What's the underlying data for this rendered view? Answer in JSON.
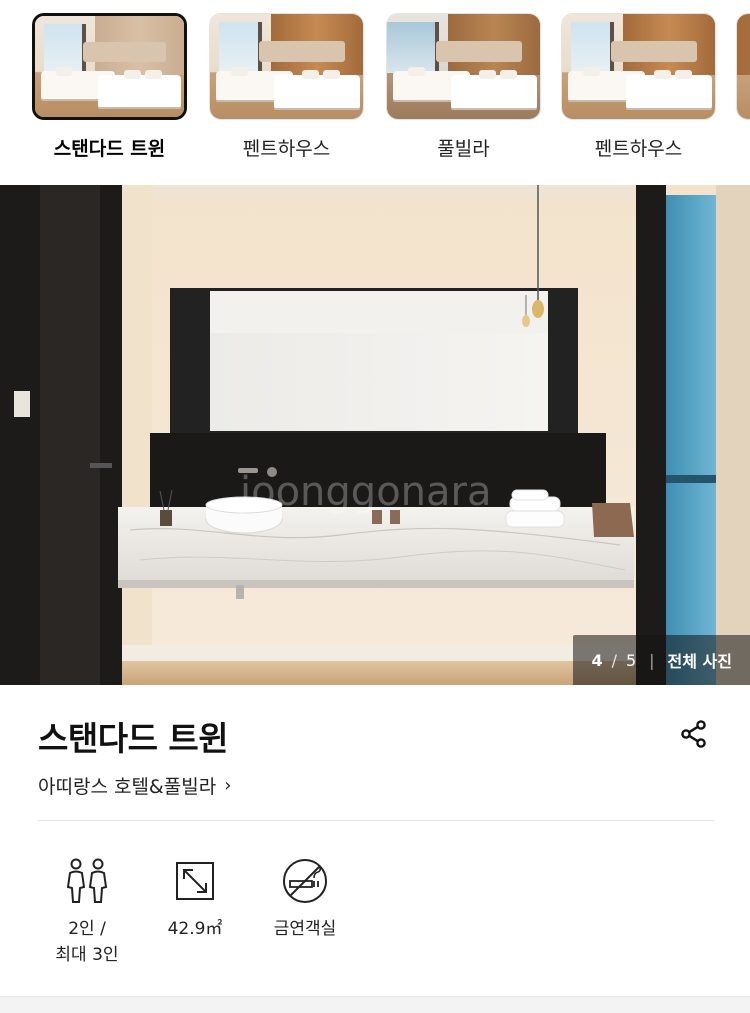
{
  "room_types": [
    {
      "label": "스탠다드 트윈",
      "selected": true
    },
    {
      "label": "펜트하우스",
      "selected": false
    },
    {
      "label": "풀빌라",
      "selected": false
    },
    {
      "label": "펜트하우스",
      "selected": false
    }
  ],
  "gallery": {
    "current": "4",
    "separator": "/",
    "total": "5",
    "view_all": "전체 사진"
  },
  "room": {
    "title": "스탠다드 트윈",
    "hotel_link": "아띠랑스 호텔&풀빌라",
    "hotel_chevron": "›"
  },
  "amenities": {
    "guests_line1": "2인 /",
    "guests_line2": "최대 3인",
    "size": "42.9㎡",
    "smoking": "금연객실"
  },
  "icons": {
    "share": "share-icon",
    "guests": "two-people-icon",
    "size": "resize-arrow-icon",
    "smoking": "no-smoking-icon"
  },
  "colors": {
    "selected_border": "#111111",
    "overlay": "#141414",
    "text": "#111111"
  }
}
